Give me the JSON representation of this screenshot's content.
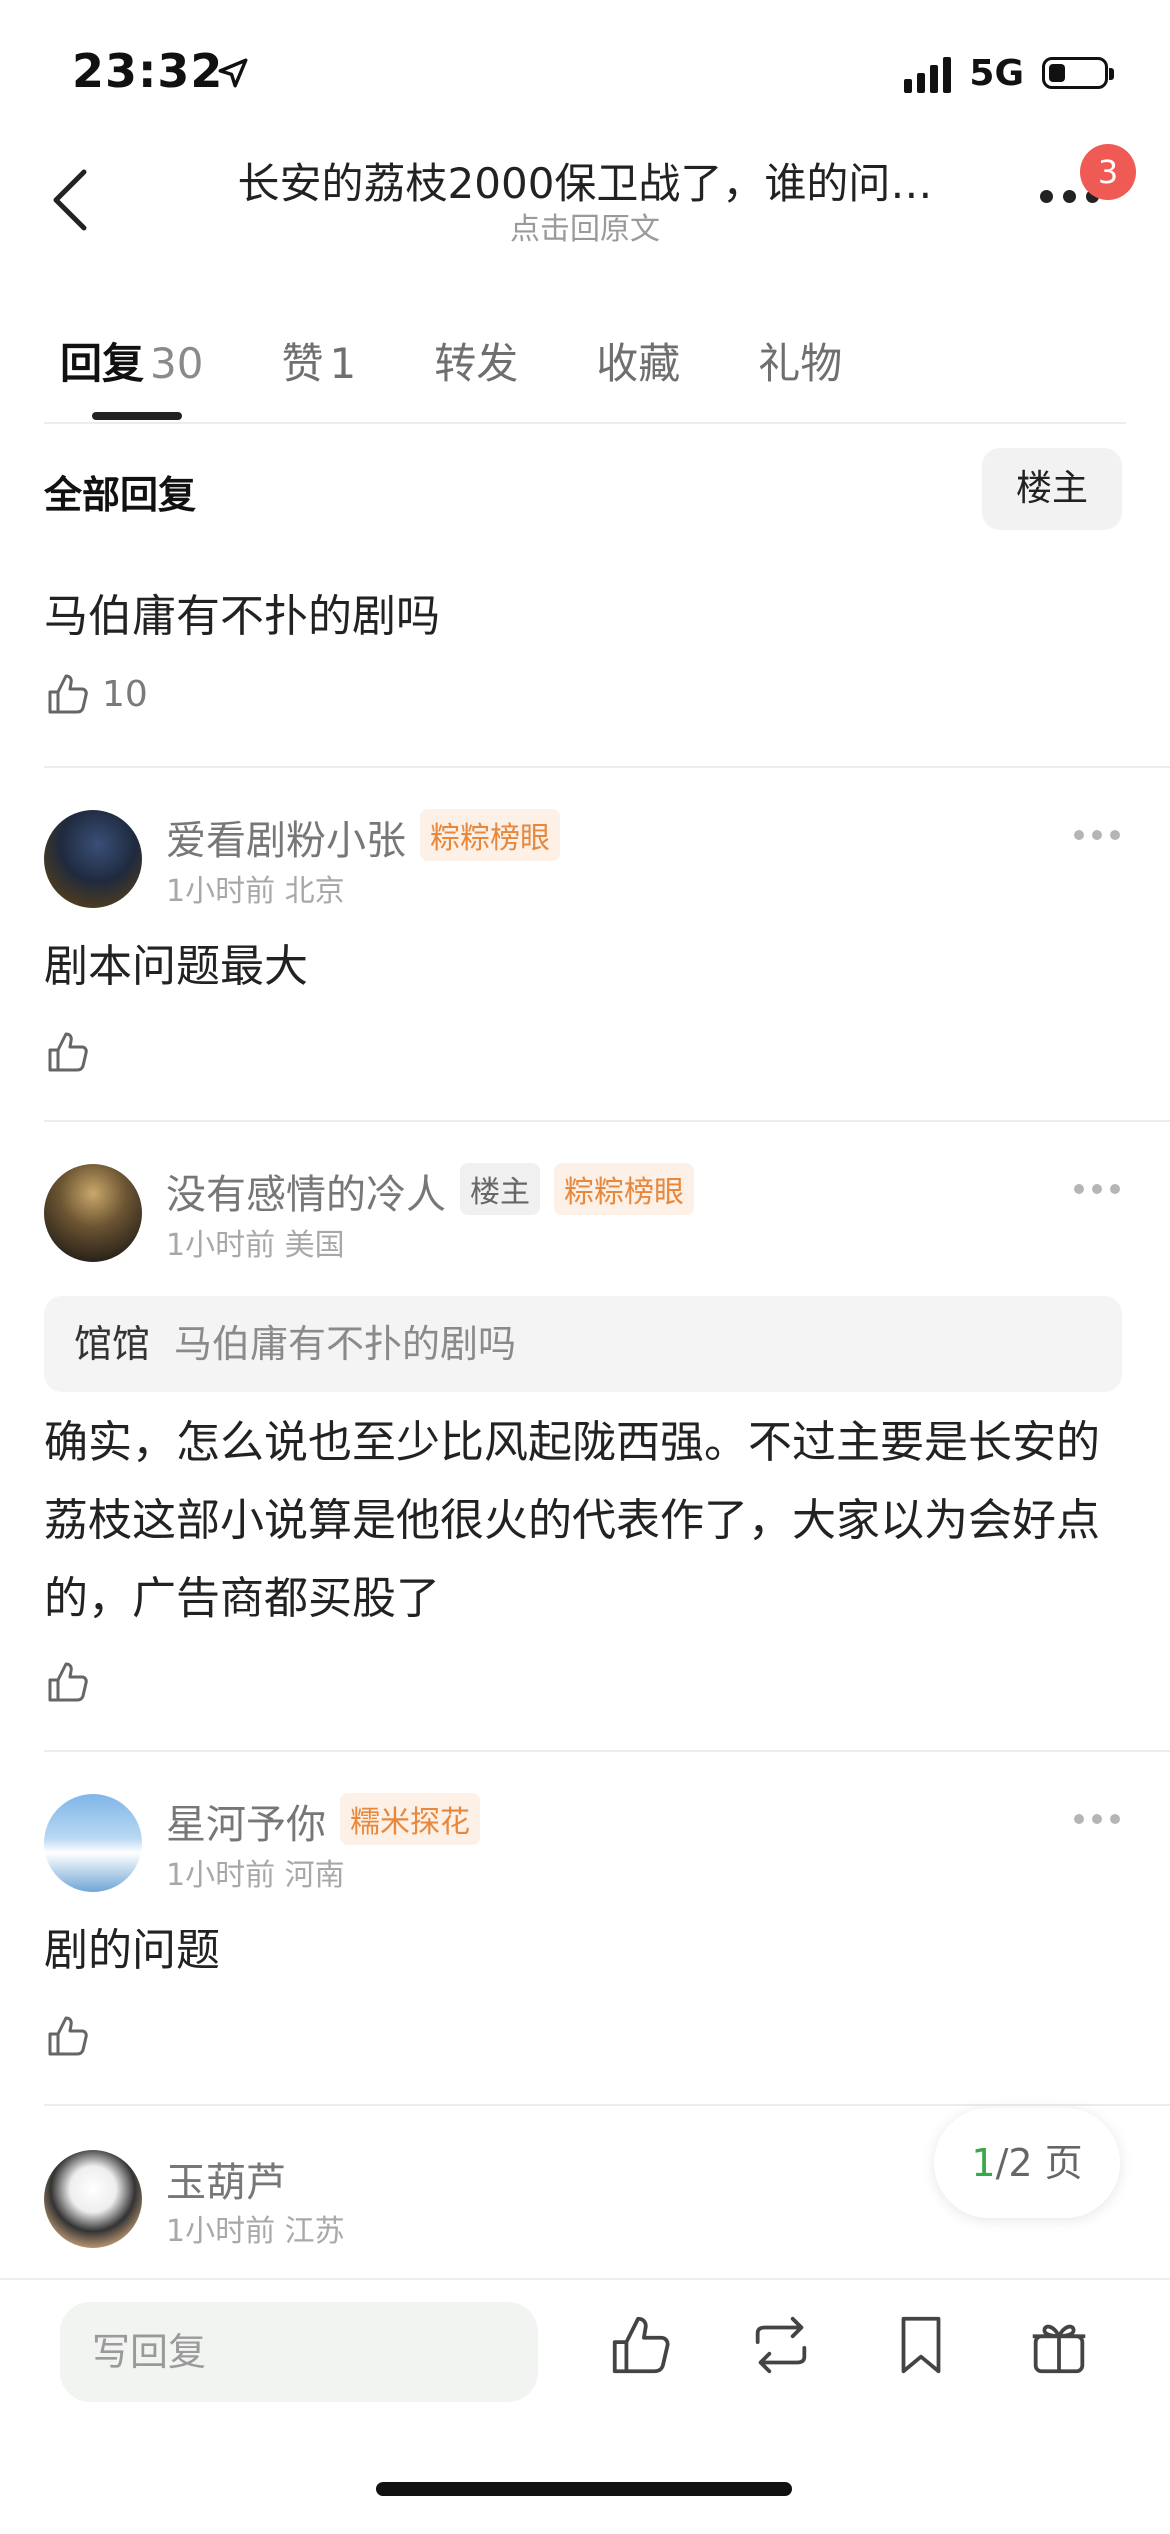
{
  "status": {
    "time": "23:32",
    "network": "5G",
    "battery_level": 0.3
  },
  "header": {
    "title": "长安的荔枝2000保卫战了，谁的问…",
    "subtitle": "点击回原文",
    "notification_count": "3"
  },
  "tabs": [
    {
      "label": "回复",
      "count": "30"
    },
    {
      "label": "赞",
      "count": "1"
    },
    {
      "label": "转发"
    },
    {
      "label": "收藏"
    },
    {
      "label": "礼物"
    }
  ],
  "filter": {
    "all_replies": "全部回复",
    "owner_only": "楼主"
  },
  "original_post": {
    "text": "马伯庸有不扑的剧吗",
    "likes": "10"
  },
  "comments": [
    {
      "name": "爱看剧粉小张",
      "tag": "粽粽榜眼",
      "meta": "1小时前 北京",
      "text": "剧本问题最大"
    },
    {
      "name": "没有感情的冷人",
      "owner_tag": "楼主",
      "tag": "粽粽榜眼",
      "meta": "1小时前 美国",
      "quote_name": "馆馆",
      "quote_text": "马伯庸有不扑的剧吗",
      "text": "确实，怎么说也至少比风起陇西强。不过主要是长安的荔枝这部小说算是他很火的代表作了，大家以为会好点的，广告商都买股了"
    },
    {
      "name": "星河予你",
      "tag": "糯米探花",
      "meta": "1小时前 河南",
      "text": "剧的问题"
    },
    {
      "name": "玉葫芦",
      "meta": "1小时前 江苏"
    }
  ],
  "pagination": {
    "current": "1",
    "total_text": "/2 页"
  },
  "bottom": {
    "reply_placeholder": "写回复"
  }
}
